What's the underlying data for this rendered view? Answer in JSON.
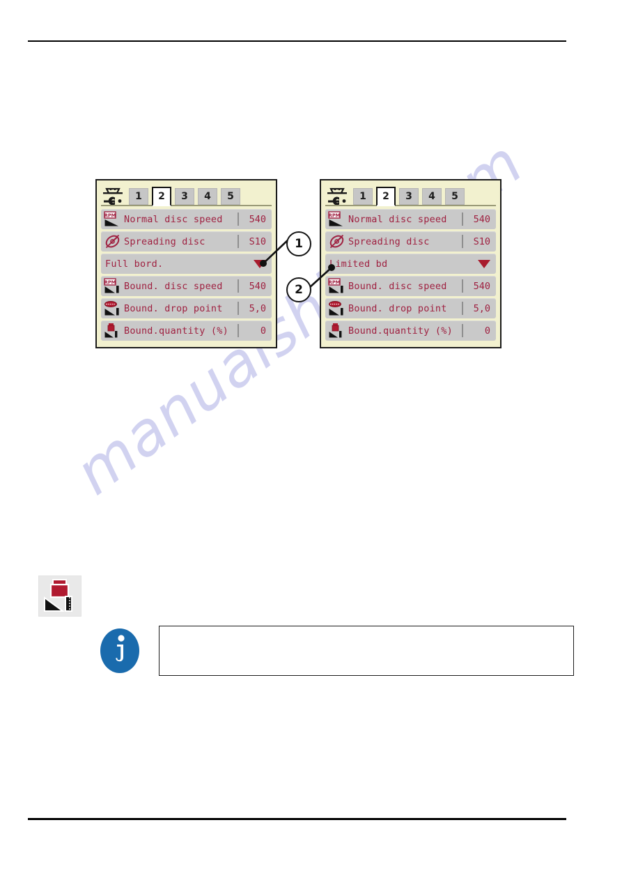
{
  "page": {
    "watermark": "manualshive.com"
  },
  "screens": [
    {
      "id": "full-border-screen",
      "machine_icon": "machine-settings-icon",
      "tabs": [
        {
          "label": "1",
          "active": false
        },
        {
          "label": "2",
          "active": true
        },
        {
          "label": "3",
          "active": false
        },
        {
          "label": "4",
          "active": false
        },
        {
          "label": "5",
          "active": false
        }
      ],
      "rows": [
        {
          "icon": "rpm-disc-speed-icon",
          "label": "Normal disc speed",
          "value": "540",
          "type": "value"
        },
        {
          "icon": "spreading-disc-icon",
          "label": "Spreading disc",
          "value": "S10",
          "type": "value"
        },
        {
          "icon": "none",
          "label": "Full bord.",
          "value": "",
          "type": "dropdown"
        },
        {
          "icon": "rpm-boundary-disc-icon",
          "label": "Bound. disc speed",
          "value": "540",
          "type": "value"
        },
        {
          "icon": "boundary-drop-point-icon",
          "label": "Bound. drop point",
          "value": "5,0",
          "type": "value"
        },
        {
          "icon": "boundary-quantity-icon",
          "label": "Bound.quantity (%)",
          "value": "0",
          "type": "value"
        }
      ]
    },
    {
      "id": "limited-border-screen",
      "machine_icon": "machine-settings-icon",
      "tabs": [
        {
          "label": "1",
          "active": false
        },
        {
          "label": "2",
          "active": true
        },
        {
          "label": "3",
          "active": false
        },
        {
          "label": "4",
          "active": false
        },
        {
          "label": "5",
          "active": false
        }
      ],
      "rows": [
        {
          "icon": "rpm-disc-speed-icon",
          "label": "Normal disc speed",
          "value": "540",
          "type": "value"
        },
        {
          "icon": "spreading-disc-icon",
          "label": "Spreading disc",
          "value": "S10",
          "type": "value"
        },
        {
          "icon": "none",
          "label": "Limited bd",
          "value": "",
          "type": "dropdown"
        },
        {
          "icon": "rpm-boundary-disc-icon",
          "label": "Bound. disc speed",
          "value": "540",
          "type": "value"
        },
        {
          "icon": "boundary-drop-point-icon",
          "label": "Bound. drop point",
          "value": "5,0",
          "type": "value"
        },
        {
          "icon": "boundary-quantity-icon",
          "label": "Bound.quantity (%)",
          "value": "0",
          "type": "value"
        }
      ]
    }
  ],
  "callouts": [
    {
      "number": "1"
    },
    {
      "number": "2"
    }
  ],
  "manual_icon": {
    "name": "boundary-quantity-icon"
  },
  "note": {
    "icon": "info-icon",
    "text": ""
  },
  "colors": {
    "screen_background": "#f2f1cf",
    "row_background": "#c9c9c9",
    "text_accent": "#9f2040",
    "caret": "#a81b2d",
    "info_blue": "#1a6bad",
    "watermark": "#c9cbee"
  }
}
